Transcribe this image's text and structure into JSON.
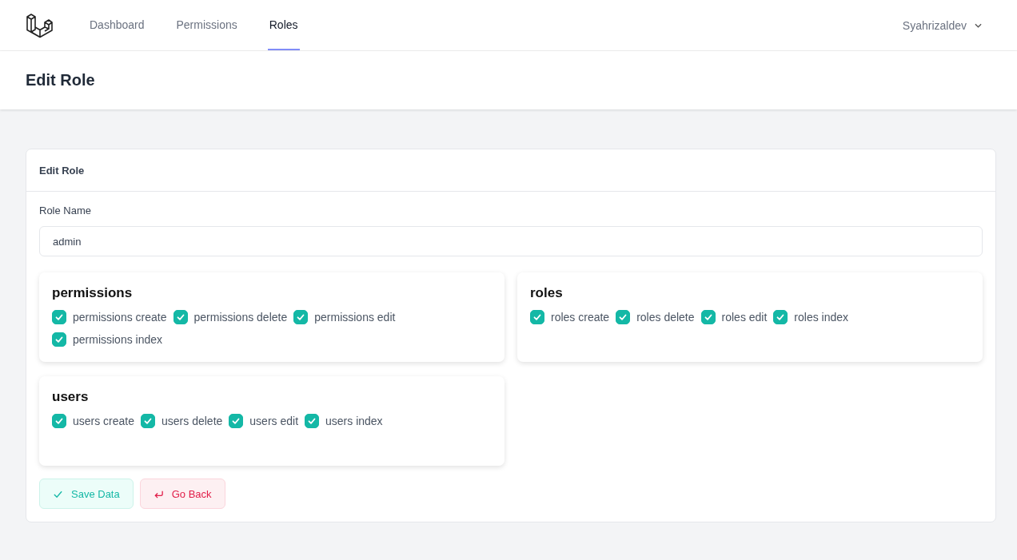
{
  "nav": {
    "links": [
      {
        "label": "Dashboard",
        "selected": false
      },
      {
        "label": "Permissions",
        "selected": false
      },
      {
        "label": "Roles",
        "selected": true
      }
    ],
    "user": "Syahrizaldev"
  },
  "page_title": "Edit Role",
  "card": {
    "title": "Edit Role",
    "field": {
      "label": "Role Name",
      "value": "admin"
    },
    "groups": [
      {
        "name": "permissions",
        "items": [
          {
            "label": "permissions create",
            "checked": true
          },
          {
            "label": "permissions delete",
            "checked": true
          },
          {
            "label": "permissions edit",
            "checked": true
          },
          {
            "label": "permissions index",
            "checked": true
          }
        ]
      },
      {
        "name": "roles",
        "items": [
          {
            "label": "roles create",
            "checked": true
          },
          {
            "label": "roles delete",
            "checked": true
          },
          {
            "label": "roles edit",
            "checked": true
          },
          {
            "label": "roles index",
            "checked": true
          }
        ]
      },
      {
        "name": "users",
        "items": [
          {
            "label": "users create",
            "checked": true
          },
          {
            "label": "users delete",
            "checked": true
          },
          {
            "label": "users edit",
            "checked": true
          },
          {
            "label": "users index",
            "checked": true
          }
        ]
      }
    ],
    "buttons": [
      {
        "label": "Save Data",
        "kind": "save"
      },
      {
        "label": "Go Back",
        "kind": "back"
      }
    ]
  }
}
